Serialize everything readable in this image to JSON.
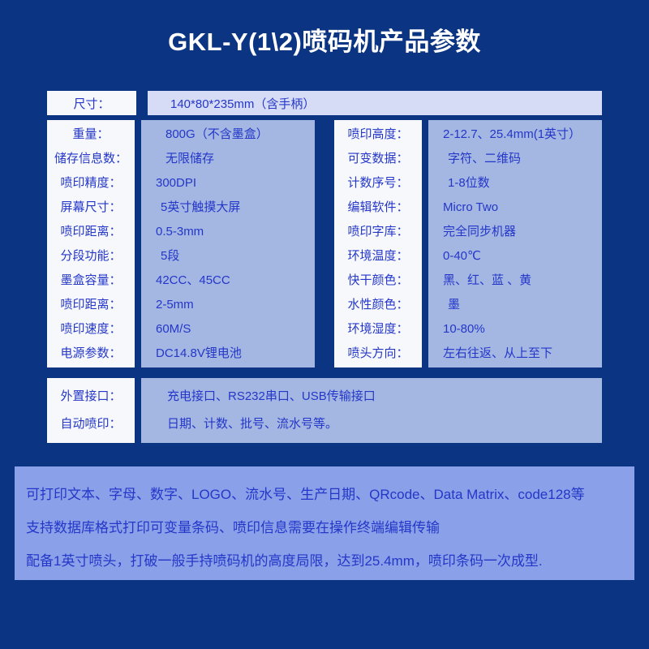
{
  "title": "GKL-Y(1\\2)喷码机产品参数",
  "dimensions": {
    "label": "尺寸：",
    "value": "140*80*235mm（含手柄）"
  },
  "spec_columns": [
    {
      "name": "left-column",
      "rows": [
        {
          "label": "重量：",
          "value": "800G（不含墨盒）"
        },
        {
          "label": "储存信息数：",
          "value": "无限储存"
        },
        {
          "label": "喷印精度：",
          "value": "300DPI"
        },
        {
          "label": "屏幕尺寸：",
          "value": "5英寸触摸大屏"
        },
        {
          "label": "喷印距离：",
          "value": "0.5-3mm"
        },
        {
          "label": "分段功能：",
          "value": "5段"
        },
        {
          "label": "墨盒容量：",
          "value": "42CC、45CC"
        },
        {
          "label": "喷印距离：",
          "value": "2-5mm"
        },
        {
          "label": "喷印速度：",
          "value": "60M/S"
        },
        {
          "label": "电源参数：",
          "value": "DC14.8V锂电池"
        }
      ]
    },
    {
      "name": "right-column",
      "rows": [
        {
          "label": "喷印高度：",
          "value": "2-12.7、25.4mm(1英寸）"
        },
        {
          "label": "可变数据：",
          "value": "字符、二维码"
        },
        {
          "label": "计数序号：",
          "value": "1-8位数"
        },
        {
          "label": "编辑软件：",
          "value": "Micro Two"
        },
        {
          "label": "喷印字库：",
          "value": "完全同步机器"
        },
        {
          "label": "环境温度：",
          "value": "0-40℃"
        },
        {
          "label": "快干颜色：",
          "value": "黑、红、蓝 、黄"
        },
        {
          "label": "水性颜色：",
          "value": "墨"
        },
        {
          "label": "环境湿度：",
          "value": "10-80%"
        },
        {
          "label": "喷头方向：",
          "value": "左右往返、从上至下"
        }
      ]
    }
  ],
  "interface_section": {
    "rows": [
      {
        "label": "外置接口：",
        "value": "充电接口、RS232串口、USB传输接口"
      },
      {
        "label": "自动喷印：",
        "value": "日期、计数、批号、流水号等。"
      }
    ]
  },
  "description": {
    "lines": [
      "可打印文本、字母、数字、LOGO、流水号、生产日期、QRcode、Data Matrix、code128等",
      "支持数据库格式打印可变量条码、喷印信息需要在操作终端编辑传输",
      "配备1英寸喷头，打破一般手持喷码机的高度局限，达到25.4mm，喷印条码一次成型."
    ]
  },
  "colors": {
    "background": "#0b3482",
    "label_cell": "#f7f8fc",
    "value_cell": "#a4b6e2",
    "dimension_value_cell": "#d7dcf6",
    "description_panel": "#8aa0e8",
    "text_blue": "#2437c8",
    "title_white": "#ffffff"
  }
}
